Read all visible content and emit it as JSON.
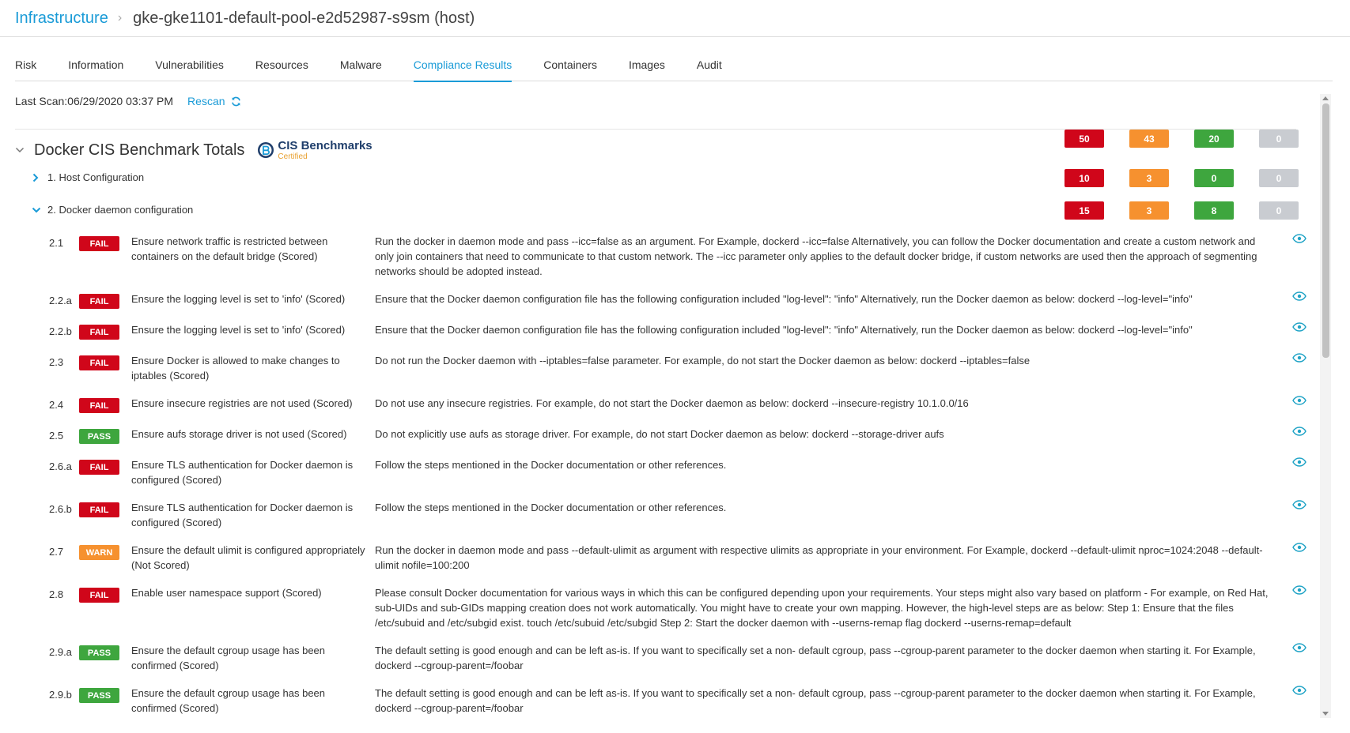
{
  "breadcrumb": {
    "link": "Infrastructure",
    "separator": "›",
    "title": "gke-gke1101-default-pool-e2d52987-s9sm (host)"
  },
  "tabs": [
    {
      "label": "Risk"
    },
    {
      "label": "Information"
    },
    {
      "label": "Vulnerabilities"
    },
    {
      "label": "Resources"
    },
    {
      "label": "Malware"
    },
    {
      "label": "Compliance Results"
    },
    {
      "label": "Containers"
    },
    {
      "label": "Images"
    },
    {
      "label": "Audit"
    }
  ],
  "active_tab": "Compliance Results",
  "scan": {
    "label": "Last Scan:06/29/2020 03:37 PM",
    "rescan": "Rescan"
  },
  "benchmark": {
    "title": "Docker CIS Benchmark Totals",
    "logo_name": "CIS Benchmarks",
    "logo_sub": "Certified",
    "totals": [
      "50",
      "43",
      "20",
      "0"
    ]
  },
  "sections": [
    {
      "label": "1. Host Configuration",
      "expanded": false,
      "counts": [
        "10",
        "3",
        "0",
        "0"
      ]
    },
    {
      "label": "2. Docker daemon configuration",
      "expanded": true,
      "counts": [
        "15",
        "3",
        "8",
        "0"
      ]
    }
  ],
  "colors": {
    "fail": "#d0061a",
    "warn": "#f6912f",
    "pass": "#3ea63e",
    "info": "#c9ccd1",
    "accent": "#1a9bd7"
  },
  "rows": [
    {
      "num": "2.1",
      "status": "FAIL",
      "title": "Ensure network traffic is restricted between containers on the default bridge (Scored)",
      "desc": "Run the docker in daemon mode and pass --icc=false as an argument. For Example, dockerd --icc=false Alternatively, you can follow the Docker documentation and create a custom network and only join containers that need to communicate to that custom network. The --icc parameter only applies to the default docker bridge, if custom networks are used then the approach of segmenting networks should be adopted instead."
    },
    {
      "num": "2.2.a",
      "status": "FAIL",
      "title": "Ensure the logging level is set to 'info' (Scored)",
      "desc": "Ensure that the Docker daemon configuration file has the following configuration included \"log-level\": \"info\" Alternatively, run the Docker daemon as below: dockerd --log-level=\"info\""
    },
    {
      "num": "2.2.b",
      "status": "FAIL",
      "title": "Ensure the logging level is set to 'info' (Scored)",
      "desc": "Ensure that the Docker daemon configuration file has the following configuration included \"log-level\": \"info\" Alternatively, run the Docker daemon as below: dockerd --log-level=\"info\""
    },
    {
      "num": "2.3",
      "status": "FAIL",
      "title": "Ensure Docker is allowed to make changes to iptables (Scored)",
      "desc": "Do not run the Docker daemon with --iptables=false parameter. For example, do not start the Docker daemon as below: dockerd --iptables=false"
    },
    {
      "num": "2.4",
      "status": "FAIL",
      "title": "Ensure insecure registries are not used (Scored)",
      "desc": "Do not use any insecure registries. For example, do not start the Docker daemon as below: dockerd --insecure-registry 10.1.0.0/16"
    },
    {
      "num": "2.5",
      "status": "PASS",
      "title": "Ensure aufs storage driver is not used (Scored)",
      "desc": "Do not explicitly use aufs as storage driver. For example, do not start Docker daemon as below: dockerd --storage-driver aufs"
    },
    {
      "num": "2.6.a",
      "status": "FAIL",
      "title": "Ensure TLS authentication for Docker daemon is configured (Scored)",
      "desc": "Follow the steps mentioned in the Docker documentation or other references."
    },
    {
      "num": "2.6.b",
      "status": "FAIL",
      "title": "Ensure TLS authentication for Docker daemon is configured (Scored)",
      "desc": "Follow the steps mentioned in the Docker documentation or other references."
    },
    {
      "num": "2.7",
      "status": "WARN",
      "title": "Ensure the default ulimit is configured appropriately (Not Scored)",
      "desc": "Run the docker in daemon mode and pass --default-ulimit as argument with respective ulimits as appropriate in your environment. For Example, dockerd --default-ulimit nproc=1024:2048 --default-ulimit nofile=100:200"
    },
    {
      "num": "2.8",
      "status": "FAIL",
      "title": "Enable user namespace support (Scored)",
      "desc": "Please consult Docker documentation for various ways in which this can be configured depending upon your requirements. Your steps might also vary based on platform - For example, on Red Hat, sub-UIDs and sub-GIDs mapping creation does not work automatically. You might have to create your own mapping. However, the high-level steps are as below: Step 1: Ensure that the files /etc/subuid and /etc/subgid exist. touch /etc/subuid /etc/subgid Step 2: Start the docker daemon with --userns-remap flag dockerd --userns-remap=default"
    },
    {
      "num": "2.9.a",
      "status": "PASS",
      "title": "Ensure the default cgroup usage has been confirmed (Scored)",
      "desc": "The default setting is good enough and can be left as-is. If you want to specifically set a non- default cgroup, pass --cgroup-parent parameter to the docker daemon when starting it. For Example, dockerd --cgroup-parent=/foobar"
    },
    {
      "num": "2.9.b",
      "status": "PASS",
      "title": "Ensure the default cgroup usage has been confirmed (Scored)",
      "desc": "The default setting is good enough and can be left as-is. If you want to specifically set a non- default cgroup, pass --cgroup-parent parameter to the docker daemon when starting it. For Example, dockerd --cgroup-parent=/foobar"
    }
  ]
}
